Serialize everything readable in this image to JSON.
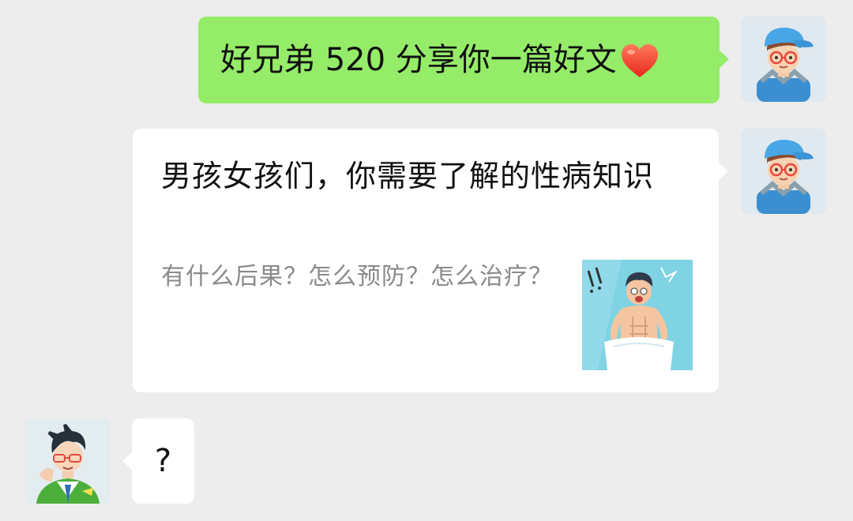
{
  "messages": {
    "outgoing_1": {
      "text": "好兄弟 520 分享你一篇好文",
      "emoji": "heart-icon"
    },
    "link_card": {
      "title": "男孩女孩们，你需要了解的性病知识",
      "description": "有什么后果？怎么预防？怎么治疗？",
      "thumbnail": "cartoon-man-with-towel"
    },
    "incoming_1": {
      "text": "?"
    }
  },
  "avatars": {
    "me": "cartoon-boy-blue-cap",
    "friend": "cartoon-boy-green-shirt"
  },
  "colors": {
    "background": "#ededed",
    "outgoing_bubble": "#95ec69",
    "incoming_bubble": "#ffffff",
    "description_text": "#8a8a8a"
  }
}
